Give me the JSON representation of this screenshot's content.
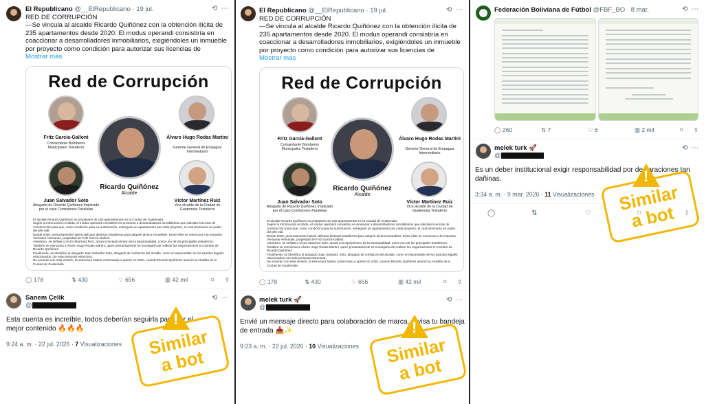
{
  "panels": {
    "left": {
      "post": {
        "author": "El Republicano",
        "handle": "@__ElRepublicano",
        "date": "19 jul.",
        "text_line1": "RED DE CORRUPCIÓN",
        "text_body": "—Se vincula al alcalde Ricardo Quiñónez con la obtención ilícita de 235 apartamentos desde 2020. El modus operandi consistiría en coaccionar a desarrolladores inmobiliarios, exigiéndoles un inmueble por proyecto como condición para autorizar sus licencias de",
        "show_more": "Mostrar más",
        "card": {
          "title": "Red de Corrupción",
          "people": [
            {
              "name": "Fritz García-Gallont",
              "role": "Comandante Bomberos Municipales Testaferro"
            },
            {
              "name": "Álvaro Hugo Rodas Martini",
              "role": "Gerente General de Empagua Intermediario"
            },
            {
              "name": "Juan Salvador Soto",
              "role": "Abogado de Ricardo Quiñónez Implicado por el caso Comisiones Paralelas"
            },
            {
              "name": "Víctor Martínez Ruiz",
              "role": "Vice alcalde de la Ciudad de Guatemala Testaferro"
            }
          ],
          "center_name": "Ricardo Quiñónez",
          "center_role": "Alcalde",
          "paragraphs": [
            "El alcalde Ricardo Quiñónez es propietario de 235 apartamentos en la Ciudad de Guatemala.",
            "Según la información recibida, el modus operandi consistiría en presionar a desarrolladores inmobiliarios que solicitan licencias de construcción para que, como condición para su autorización, entreguen un apartamento por cada proyecto, el cual terminaría en poder del jefe edil.",
            "Desde 2020, presuntamente habría utilizado distintos testaferros para adquirir dichos inmuebles. Entre ellos se menciona a la empresa Ventanas Alemanas, propiedad de Fritz García-Gallont.",
            "Asimismo, se señala a Víctor Martínez Ruiz, actual concejal primero de la Municipalidad, como uno de los principales testaferros. También se menciona a Álvaro Hugo Rodas Martini, quien presuntamente se encargaría de realizar los negociaciones en nombre de Ricardo Quiñónez.",
            "Finalmente, se identifica al abogado Juan Salvador Soto, abogado de confianza del alcalde, como el responsable de los asuntos legales relacionados con esta presunta estructura.",
            "De acuerdo con esta versión, la estructura habría comenzado a operar en 2020, cuando Ricardo Quiñónez asumió la Alcaldía de la Ciudad de Guatemala."
          ]
        },
        "replies": "178",
        "reposts": "430",
        "likes": "656",
        "views": "42 mil"
      },
      "reply": {
        "author": "Sanem Çelik",
        "handle": "@",
        "text": "Esta cuenta es increíble, todos deberían seguirla para ver el mejor contenido 🔥🔥🔥",
        "time": "9:24 a. m. · 22 jul. 2026 ·",
        "views_count": "7",
        "views_label": "Visualizaciones"
      },
      "stamp": {
        "line1": "Similar",
        "line2": "a bot"
      }
    },
    "middle": {
      "post": {
        "author": "El Republicano",
        "handle": "@__ElRepublicano",
        "date": "19 jul.",
        "text_line1": "RED DE CORRUPCIÓN",
        "text_body": "—Se vincula al alcalde Ricardo Quiñónez con la obtención ilícita de 235 apartamentos desde 2020. El modus operandi consistiría en coaccionar a desarrolladores inmobiliarios, exigiéndoles un inmueble por proyecto como condición para autorizar sus licencias de",
        "show_more": "Mostrar más",
        "replies": "178",
        "reposts": "430",
        "likes": "656",
        "views": "42 mil"
      },
      "reply": {
        "author": "melek turk 🚀",
        "handle": "@",
        "text": "Envié un mensaje directo para colaboración de marca, revisa tu bandeja de entrada 📥✨",
        "time": "9:23 a. m. · 22 jul. 2026 ·",
        "views_count": "10",
        "views_label": "Visualizaciones"
      },
      "stamp": {
        "line1": "Similar",
        "line2": "a bot"
      }
    },
    "right": {
      "post": {
        "author": "Federación Boliviana de Fútbol",
        "handle": "@FBF_BO",
        "date": "8 mar.",
        "replies": "260",
        "reposts": "7",
        "likes": "6",
        "views": "2 mil"
      },
      "reply": {
        "author": "melek turk 🚀",
        "handle": "@",
        "text": "Es un deber institucional exigir responsabilidad por declaraciones tan dañinas.",
        "time": "3:34 a. m. · 9 mar. 2026 ·",
        "views_count": "11",
        "views_label": "Visualizaciones"
      },
      "stamp": {
        "line1": "Similar",
        "line2": "a bot"
      }
    }
  },
  "colors": {
    "stamp": "#f2b705",
    "link": "#1d9bf0",
    "muted": "#536471"
  }
}
